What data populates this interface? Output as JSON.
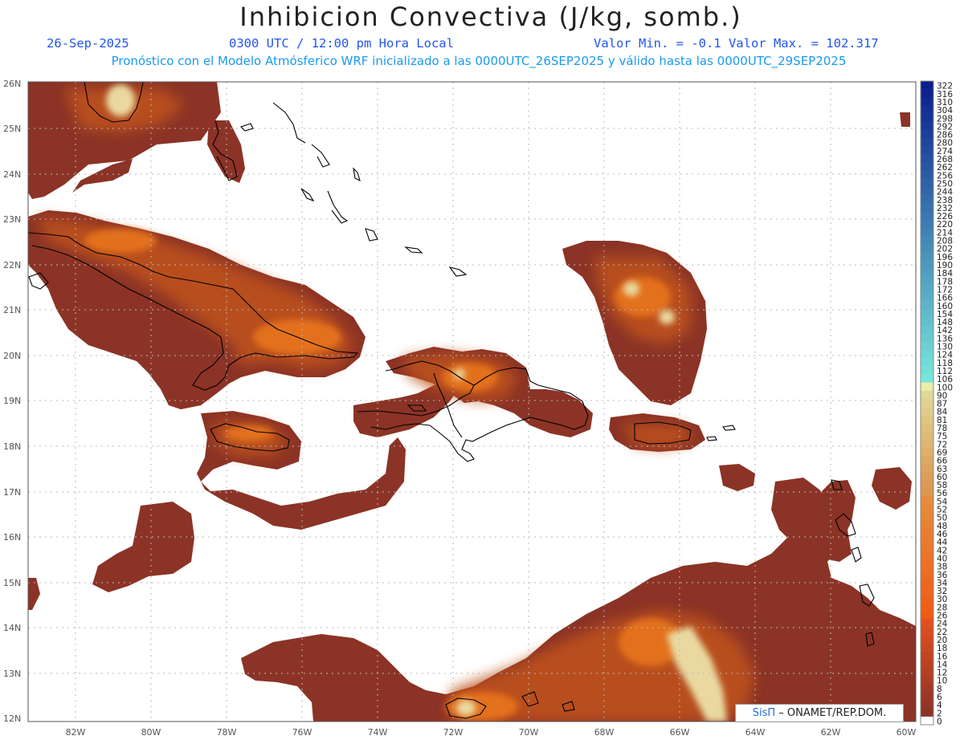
{
  "header": {
    "title": "Inhibicion Convectiva (J/kg, somb.)",
    "date": "26-Sep-2025",
    "time": "0300 UTC / 12:00 pm Hora Local",
    "stats": "Valor Min. = -0.1  Valor Max. = 102.317",
    "description": "Pronóstico con el Modelo Atmósferico WRF inicializado a las 0000UTC_26SEP2025 y válido hasta las  0000UTC_29SEP2025"
  },
  "axes": {
    "lat_labels": [
      "26N",
      "25N",
      "24N",
      "23N",
      "22N",
      "21N",
      "20N",
      "19N",
      "18N",
      "17N",
      "16N",
      "15N",
      "14N",
      "13N",
      "12N"
    ],
    "lon_labels": [
      "82W",
      "80W",
      "78W",
      "76W",
      "74W",
      "72W",
      "70W",
      "68W",
      "66W",
      "64W",
      "62W",
      "60W"
    ]
  },
  "colorbar": {
    "labels": [
      "322",
      "316",
      "310",
      "304",
      "298",
      "292",
      "286",
      "280",
      "274",
      "268",
      "262",
      "256",
      "250",
      "244",
      "238",
      "232",
      "226",
      "220",
      "214",
      "208",
      "202",
      "196",
      "190",
      "184",
      "178",
      "172",
      "166",
      "160",
      "154",
      "148",
      "142",
      "136",
      "130",
      "124",
      "118",
      "112",
      "106",
      "100",
      "90",
      "87",
      "84",
      "81",
      "78",
      "75",
      "72",
      "69",
      "66",
      "63",
      "60",
      "58",
      "56",
      "54",
      "52",
      "50",
      "48",
      "46",
      "44",
      "42",
      "40",
      "38",
      "36",
      "34",
      "32",
      "30",
      "28",
      "26",
      "24",
      "22",
      "20",
      "18",
      "16",
      "14",
      "12",
      "10",
      "8",
      "6",
      "4",
      "2",
      "0"
    ]
  },
  "credit": {
    "logo": "SisΠ",
    "text": "– ONAMET/REP.DOM."
  },
  "colors": {
    "field_base": "#8b3326",
    "field_mid": "#c0521e",
    "field_high": "#e8751a",
    "field_peak": "#e9d9a0",
    "coast": "#000000",
    "grid": "#b8b8b8"
  }
}
